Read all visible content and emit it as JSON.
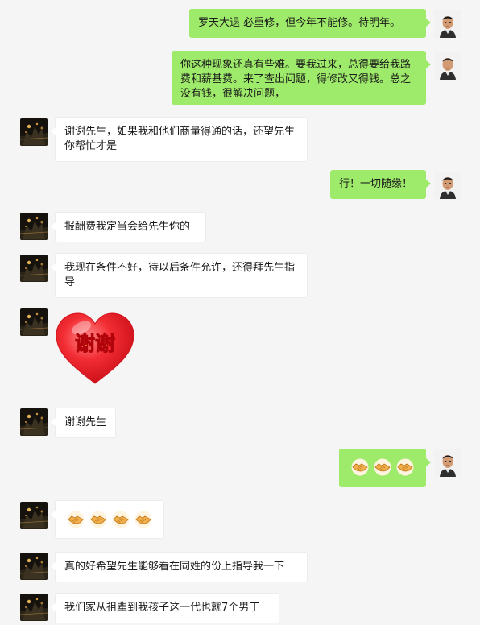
{
  "messages": [
    {
      "side": "self",
      "type": "text",
      "text": "罗天大退  必重修，但今年不能修。待明年。"
    },
    {
      "side": "self",
      "type": "text",
      "text": "你这种现象还真有些难。要我过来，总得要给我路费和薪基费。来了查出问题，得修改又得钱。总之没有钱，很解决问题，"
    },
    {
      "side": "other",
      "type": "text",
      "text": "谢谢先生，如果我和他们商量得通的话，还望先生你帮忙才是"
    },
    {
      "side": "self",
      "type": "text",
      "text": "行！一切随缘！"
    },
    {
      "side": "other",
      "type": "text",
      "text": "报酬费我定当会给先生你的"
    },
    {
      "side": "other",
      "type": "text",
      "text": "我现在条件不好，待以后条件允许，还得拜先生指导"
    },
    {
      "side": "other",
      "type": "sticker",
      "text": "谢谢"
    },
    {
      "side": "other",
      "type": "text",
      "text": "谢谢先生"
    },
    {
      "side": "self",
      "type": "emoji",
      "icon": "handshake-icon",
      "count": 3
    },
    {
      "side": "other",
      "type": "emoji",
      "icon": "handshake-icon",
      "count": 4
    },
    {
      "side": "other",
      "type": "text",
      "text": "真的好希望先生能够看在同姓的份上指导我一下"
    },
    {
      "side": "other",
      "type": "text",
      "text": "我们家从祖辈到我孩子这一代也就7个男丁"
    }
  ],
  "colors": {
    "background": "#f5f5f5",
    "self_bubble": "#9eea6a",
    "other_bubble": "#ffffff",
    "sticker_heart": "#e8202a",
    "sticker_text": "#ffe81a"
  }
}
